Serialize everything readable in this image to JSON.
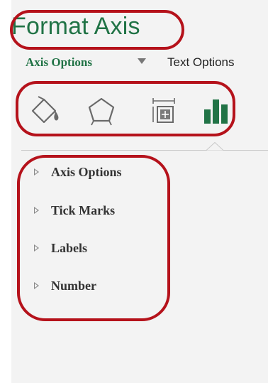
{
  "pane": {
    "title": "Format Axis",
    "tabs": [
      {
        "label": "Axis Options",
        "icon": "chevron-down-icon",
        "selected": true
      },
      {
        "label": "Text Options",
        "selected": false
      }
    ],
    "category_icons": [
      {
        "name": "fill-line-icon",
        "selected": false
      },
      {
        "name": "effects-icon",
        "selected": false
      },
      {
        "name": "size-properties-icon",
        "selected": false
      },
      {
        "name": "axis-options-icon",
        "selected": true
      }
    ],
    "sections": [
      {
        "label": "Axis Options",
        "expanded": false
      },
      {
        "label": "Tick Marks",
        "expanded": false
      },
      {
        "label": "Labels",
        "expanded": false
      },
      {
        "label": "Number",
        "expanded": false
      }
    ]
  },
  "colors": {
    "accent": "#217346",
    "annotation": "#b5121b",
    "pane_background": "#f3f3f3"
  }
}
